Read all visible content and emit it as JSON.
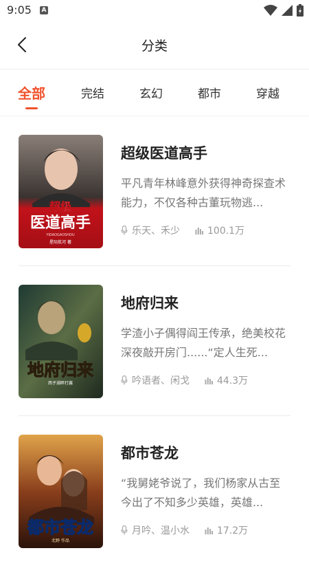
{
  "status": {
    "time": "9:05",
    "notification_letter": "A"
  },
  "header": {
    "title": "分类"
  },
  "tabs": [
    {
      "label": "全部",
      "active": true
    },
    {
      "label": "完结",
      "active": false
    },
    {
      "label": "玄幻",
      "active": false
    },
    {
      "label": "都市",
      "active": false
    },
    {
      "label": "穿越",
      "active": false
    }
  ],
  "colors": {
    "accent": "#f0522c"
  },
  "books": [
    {
      "title": "超级医道高手",
      "description": "平凡青年林峰意外获得神奇探查术能力，不仅各种古董玩物逃...",
      "authors": "乐天、禾少",
      "popularity": "100.1万",
      "cover_text": "超级医道高手",
      "cover_subtext": "YIDAOGAOSHOU",
      "cover_author": "星际航河 著"
    },
    {
      "title": "地府归来",
      "description": "学渣小子偶得阎王传承，绝美校花深夜敲开房门......“定人生死...",
      "authors": "吟语者、闲戈",
      "popularity": "44.3万",
      "cover_text": "地府归来",
      "cover_author": "西子湖畔打酱"
    },
    {
      "title": "都市苍龙",
      "description": "“我舅姥爷说了，我们杨家从古至今出了不知多少英雄，英雄...",
      "authors": "月吟、温小水",
      "popularity": "17.2万",
      "cover_text": "都市苍龙",
      "cover_author": "北野 作品"
    }
  ]
}
